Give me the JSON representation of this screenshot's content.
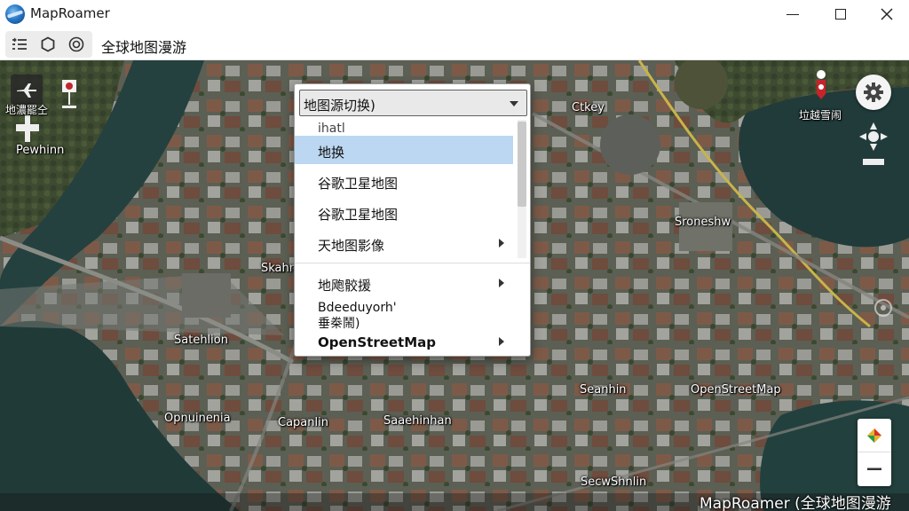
{
  "window": {
    "title": "MapRoamer",
    "controls": [
      "minimize",
      "maximize",
      "close"
    ]
  },
  "toolbar": {
    "title": "全球地图漫游",
    "icons": [
      "list-icon",
      "hexagon-icon",
      "target-icon"
    ]
  },
  "map_labels": {
    "l1": "Pewhinn",
    "l2": "Ctkey",
    "l3": "Sroneshw",
    "l4": "Skahn",
    "l5": "Satehlion",
    "l6": "Opnuinenia",
    "l7": "Capanlin",
    "l8": "Saaehinhan",
    "l9": "Seanhin",
    "l10": "OpenStreetMap",
    "l11": "SecwShnlin",
    "pin_label": "垃越雪闹",
    "compass_label": "地濃罷仝"
  },
  "dropdown": {
    "selected_value": "地图源切换)",
    "partial_top": "ihatl",
    "items": [
      {
        "label": "地换",
        "selected": true,
        "submenu": false
      },
      {
        "label": "谷歌卫星地图",
        "selected": false,
        "submenu": false
      },
      {
        "label": "谷歌卫星地图",
        "selected": false,
        "submenu": false
      },
      {
        "label": "天地图影像",
        "selected": false,
        "submenu": true
      },
      {
        "label": "地飑骹援",
        "selected": false,
        "submenu": true
      }
    ],
    "item_garbled_1": "Bdeeduyorh'",
    "item_garbled_2": "垂桊鬧)",
    "item_last": "OpenStreetMap"
  },
  "footer": {
    "label": "MapRoamer (全球地图漫游"
  },
  "colors": {
    "selection": "#bcd7f1",
    "water": "#24413f",
    "road_highlight": "#c9b448"
  }
}
